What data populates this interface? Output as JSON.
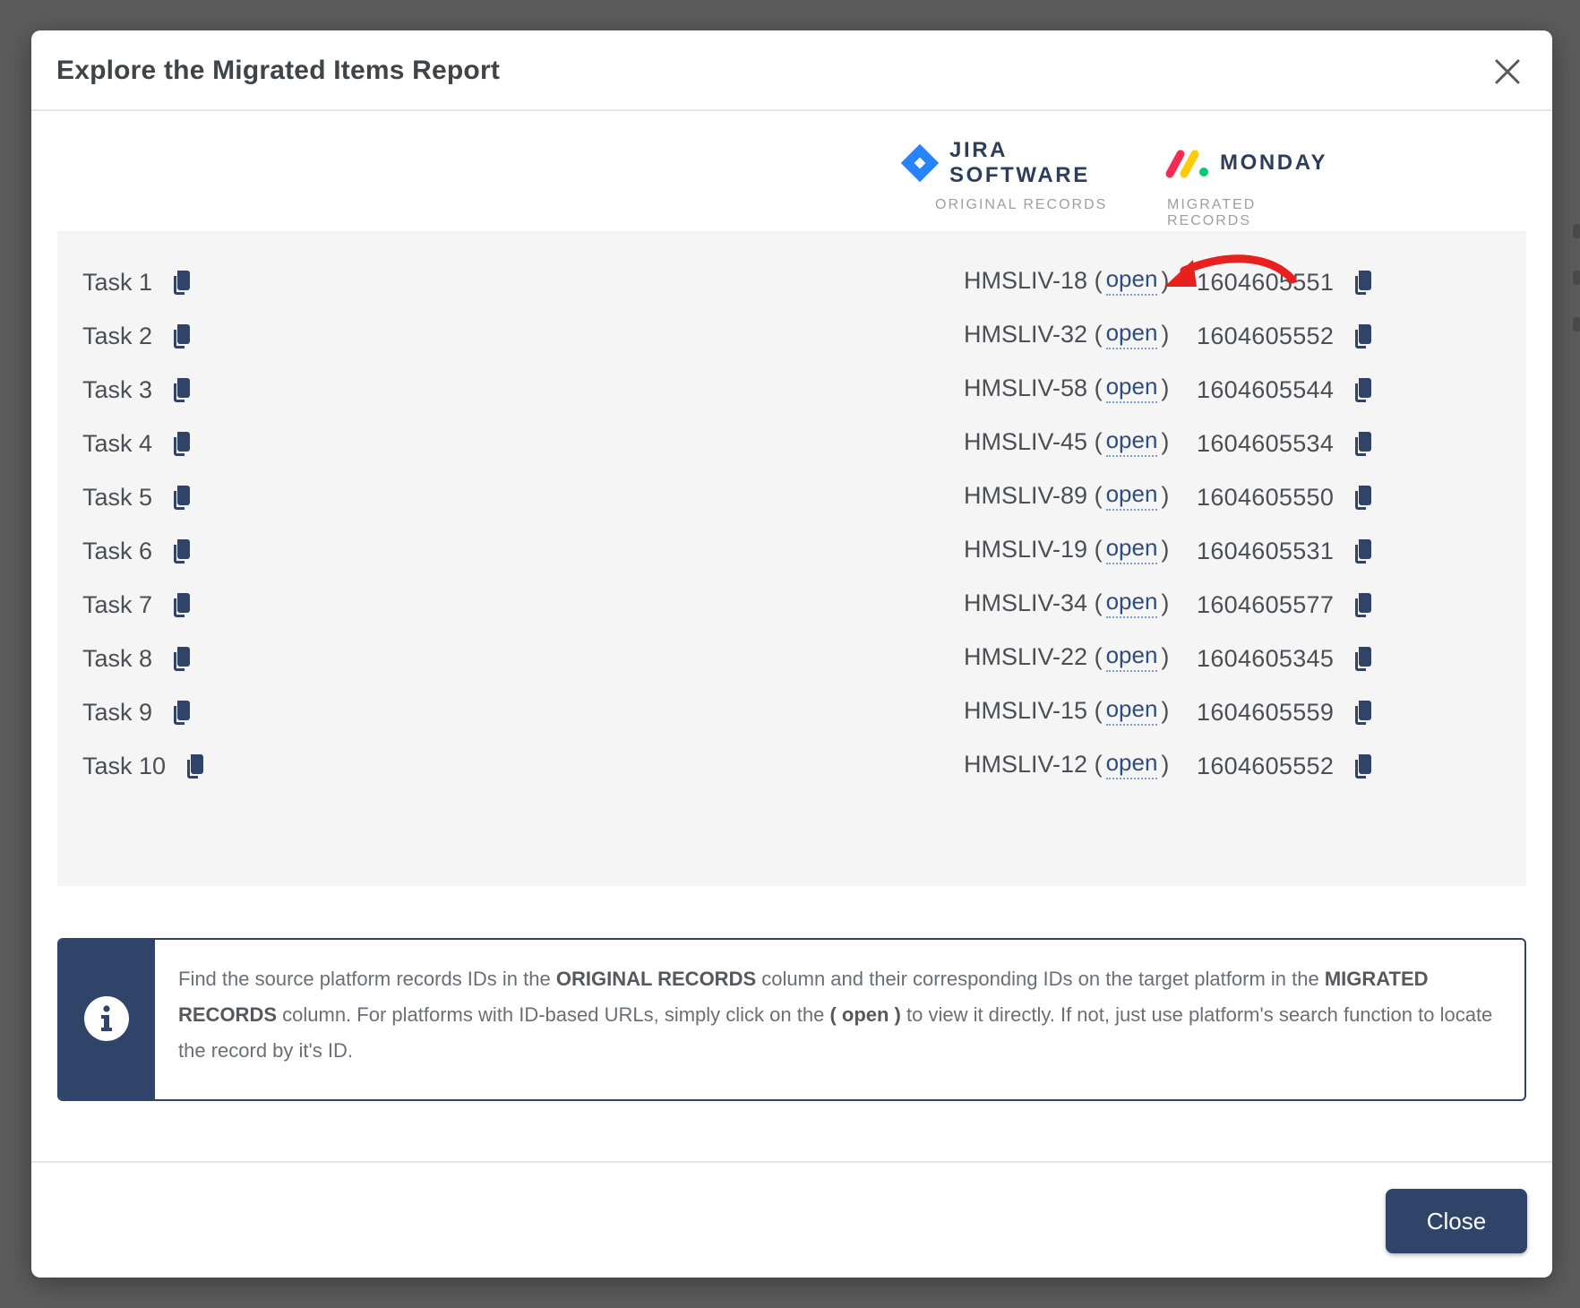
{
  "modal": {
    "title": "Explore the Migrated Items Report",
    "close_button_label": "Close"
  },
  "platforms": {
    "source": {
      "name": "JIRA SOFTWARE",
      "subtitle": "ORIGINAL RECORDS",
      "icon": "jira-logo",
      "color": "#2684FF"
    },
    "target": {
      "name": "MONDAY",
      "subtitle": "MIGRATED RECORDS",
      "icon": "monday-logo",
      "colors": [
        "#F62B54",
        "#FFCC00",
        "#00CA72"
      ]
    }
  },
  "records": [
    {
      "task": "Task 1",
      "original_id": "HMSLIV-18",
      "open_label": "open",
      "migrated_id": "1604605551"
    },
    {
      "task": "Task 2",
      "original_id": "HMSLIV-32",
      "open_label": "open",
      "migrated_id": "1604605552"
    },
    {
      "task": "Task 3",
      "original_id": "HMSLIV-58",
      "open_label": "open",
      "migrated_id": "1604605544"
    },
    {
      "task": "Task 4",
      "original_id": "HMSLIV-45",
      "open_label": "open",
      "migrated_id": "1604605534"
    },
    {
      "task": "Task 5",
      "original_id": "HMSLIV-89",
      "open_label": "open",
      "migrated_id": "1604605550"
    },
    {
      "task": "Task 6",
      "original_id": "HMSLIV-19",
      "open_label": "open",
      "migrated_id": "1604605531"
    },
    {
      "task": "Task 7",
      "original_id": "HMSLIV-34",
      "open_label": "open",
      "migrated_id": "1604605577"
    },
    {
      "task": "Task 8",
      "original_id": "HMSLIV-22",
      "open_label": "open",
      "migrated_id": "1604605345"
    },
    {
      "task": "Task 9",
      "original_id": "HMSLIV-15",
      "open_label": "open",
      "migrated_id": "1604605559"
    },
    {
      "task": "Task 10",
      "original_id": "HMSLIV-12",
      "open_label": "open",
      "migrated_id": "1604605552"
    }
  ],
  "info": {
    "icon": "info-icon",
    "text_1": "Find the source platform records IDs in the ",
    "bold_1": "ORIGINAL RECORDS",
    "text_2": " column and their corresponding IDs on the target platform in the ",
    "bold_2": "MIGRATED RECORDS",
    "text_3": " column. For platforms with ID-based URLs, simply click on the ",
    "bold_3": "( open )",
    "text_4": " to view it directly. If not, just use platform's search function to locate the record by it's ID."
  },
  "colors": {
    "primary": "#2F4468",
    "link": "#2F4D7C",
    "annotation_arrow": "#E8201E"
  }
}
